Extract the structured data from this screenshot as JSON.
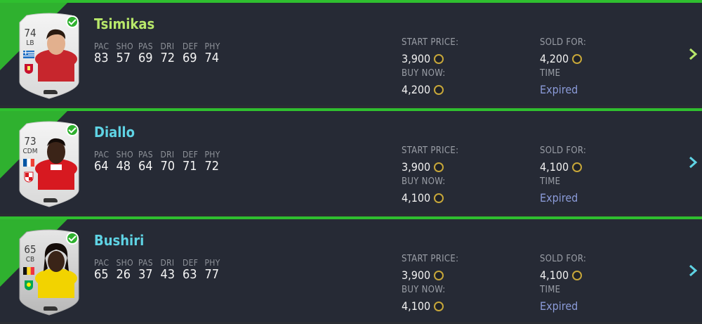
{
  "colors": {
    "accent_green": "#2fb12f",
    "name_lime": "#b8e86a",
    "name_cyan": "#5fd3e4",
    "expired": "#8a9ad7"
  },
  "stat_labels": [
    "PAC",
    "SHO",
    "PAS",
    "DRI",
    "DEF",
    "PHY"
  ],
  "labels": {
    "start_price": "START PRICE:",
    "buy_now": "BUY NOW:",
    "sold_for": "SOLD FOR:",
    "time": "TIME"
  },
  "items": [
    {
      "name": "Tsimikas",
      "name_color": "#b8e86a",
      "rating": "74",
      "position": "LB",
      "stats": [
        "83",
        "57",
        "69",
        "72",
        "69",
        "74"
      ],
      "start_price": "3,900",
      "buy_now": "4,200",
      "sold_for": "4,200",
      "time": "Expired",
      "chevron_color": "#b8e86a",
      "card_style": "gold-white"
    },
    {
      "name": "Diallo",
      "name_color": "#5fd3e4",
      "rating": "73",
      "position": "CDM",
      "stats": [
        "64",
        "48",
        "64",
        "70",
        "71",
        "72"
      ],
      "start_price": "3,900",
      "buy_now": "4,100",
      "sold_for": "4,100",
      "time": "Expired",
      "chevron_color": "#5fd3e4",
      "card_style": "gold-white"
    },
    {
      "name": "Bushiri",
      "name_color": "#5fd3e4",
      "rating": "65",
      "position": "CB",
      "stats": [
        "65",
        "26",
        "37",
        "43",
        "63",
        "77"
      ],
      "start_price": "3,900",
      "buy_now": "4,100",
      "sold_for": "4,100",
      "time": "Expired",
      "chevron_color": "#5fd3e4",
      "card_style": "silver"
    }
  ]
}
